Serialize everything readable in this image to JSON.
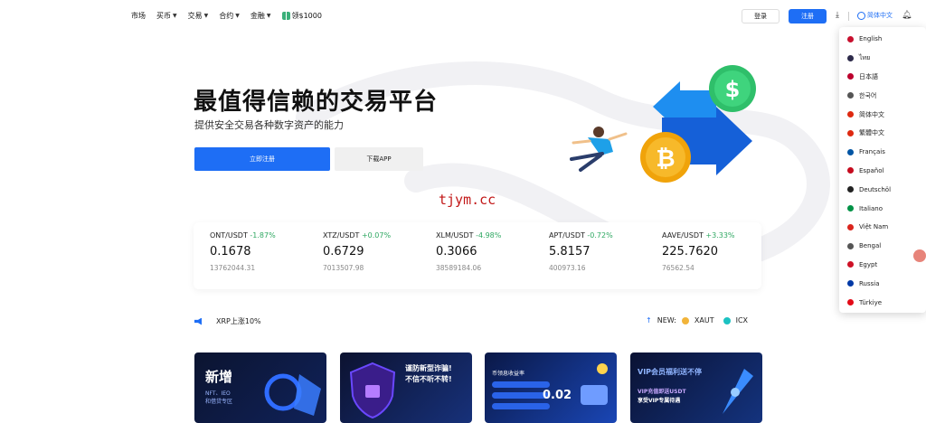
{
  "nav": {
    "items": [
      {
        "label": "市场",
        "caret": false
      },
      {
        "label": "买币",
        "caret": true
      },
      {
        "label": "交易",
        "caret": true
      },
      {
        "label": "合约",
        "caret": true
      },
      {
        "label": "金融",
        "caret": true
      }
    ],
    "promo": "领$1000",
    "login": "登录",
    "register": "注册",
    "language": "简体中文"
  },
  "hero": {
    "title": "最值得信赖的交易平台",
    "subtitle": "提供安全交易各种数字资产的能力",
    "primary_cta": "立即注册",
    "secondary_cta": "下载APP",
    "watermark": "tjym.cc"
  },
  "tickers": [
    {
      "pair": "ONT/USDT",
      "change": "-1.87%",
      "price": "0.1678",
      "volume": "13762044.31"
    },
    {
      "pair": "XTZ/USDT",
      "change": "+0.07%",
      "price": "0.6729",
      "volume": "7013507.98"
    },
    {
      "pair": "XLM/USDT",
      "change": "-4.98%",
      "price": "0.3066",
      "volume": "38589184.06"
    },
    {
      "pair": "APT/USDT",
      "change": "-0.72%",
      "price": "5.8157",
      "volume": "400973.16"
    },
    {
      "pair": "AAVE/USDT",
      "change": "+3.33%",
      "price": "225.7620",
      "volume": "76562.54"
    }
  ],
  "announcement": {
    "text": "XRP上涨10%",
    "new_label": "NEW:",
    "new_coins": [
      "XAUT",
      "ICX"
    ]
  },
  "banners": {
    "b1_title": "新增",
    "b1_sub1": "NFT、IEO",
    "b1_sub2": "和借贷专区",
    "b2_title1": "谨防新型诈骗!",
    "b2_title2": "不信不听不转!",
    "b3_title": "币领息收益率",
    "b3_rate": "0.02",
    "b4_title": "VIP会员福利送不停",
    "b4_sub1": "VIP充值即送USDT",
    "b4_sub2": "享受VIP专属待遇"
  },
  "languages": [
    {
      "label": "English",
      "color": "#c8102e"
    },
    {
      "label": "ไทย",
      "color": "#2d2a4a"
    },
    {
      "label": "日本語",
      "color": "#bc002d"
    },
    {
      "label": "한국어",
      "color": "#555555"
    },
    {
      "label": "简体中文",
      "color": "#de2910"
    },
    {
      "label": "繁體中文",
      "color": "#de2910"
    },
    {
      "label": "Français",
      "color": "#0055a4"
    },
    {
      "label": "Español",
      "color": "#c60b1e"
    },
    {
      "label": "Deutschöl",
      "color": "#222222"
    },
    {
      "label": "Italiano",
      "color": "#009246"
    },
    {
      "label": "Việt Nam",
      "color": "#da251d"
    },
    {
      "label": "Bengal",
      "color": "#555555"
    },
    {
      "label": "Egypt",
      "color": "#ce1126"
    },
    {
      "label": "Russia",
      "color": "#0039a6"
    },
    {
      "label": "Türkiye",
      "color": "#e30a17"
    }
  ],
  "colors": {
    "accent": "#1e6ef5",
    "up": "#2fa862"
  }
}
